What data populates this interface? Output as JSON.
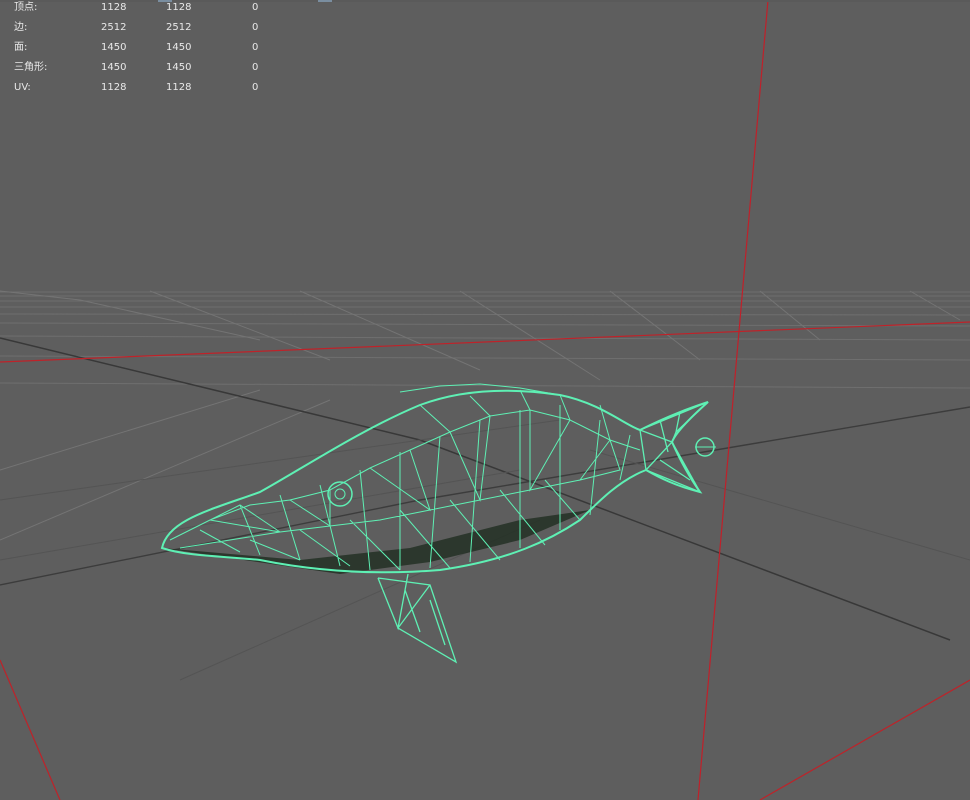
{
  "viewport": {
    "background": "#5e5e5e",
    "grid_color": "#6d6d6d",
    "grid_dark_color": "#3a3a3a",
    "axis_color": "#c0202a",
    "wireframe_color": "#5ef0b4"
  },
  "hud": {
    "rows": [
      {
        "label": "顶点:",
        "v1": "1128",
        "v2": "1128",
        "v3": "0"
      },
      {
        "label": "边:",
        "v1": "2512",
        "v2": "2512",
        "v3": "0"
      },
      {
        "label": "面:",
        "v1": "1450",
        "v2": "1450",
        "v3": "0"
      },
      {
        "label": "三角形:",
        "v1": "1450",
        "v2": "1450",
        "v3": "0"
      },
      {
        "label": "UV:",
        "v1": "1128",
        "v2": "1128",
        "v3": "0"
      }
    ]
  }
}
